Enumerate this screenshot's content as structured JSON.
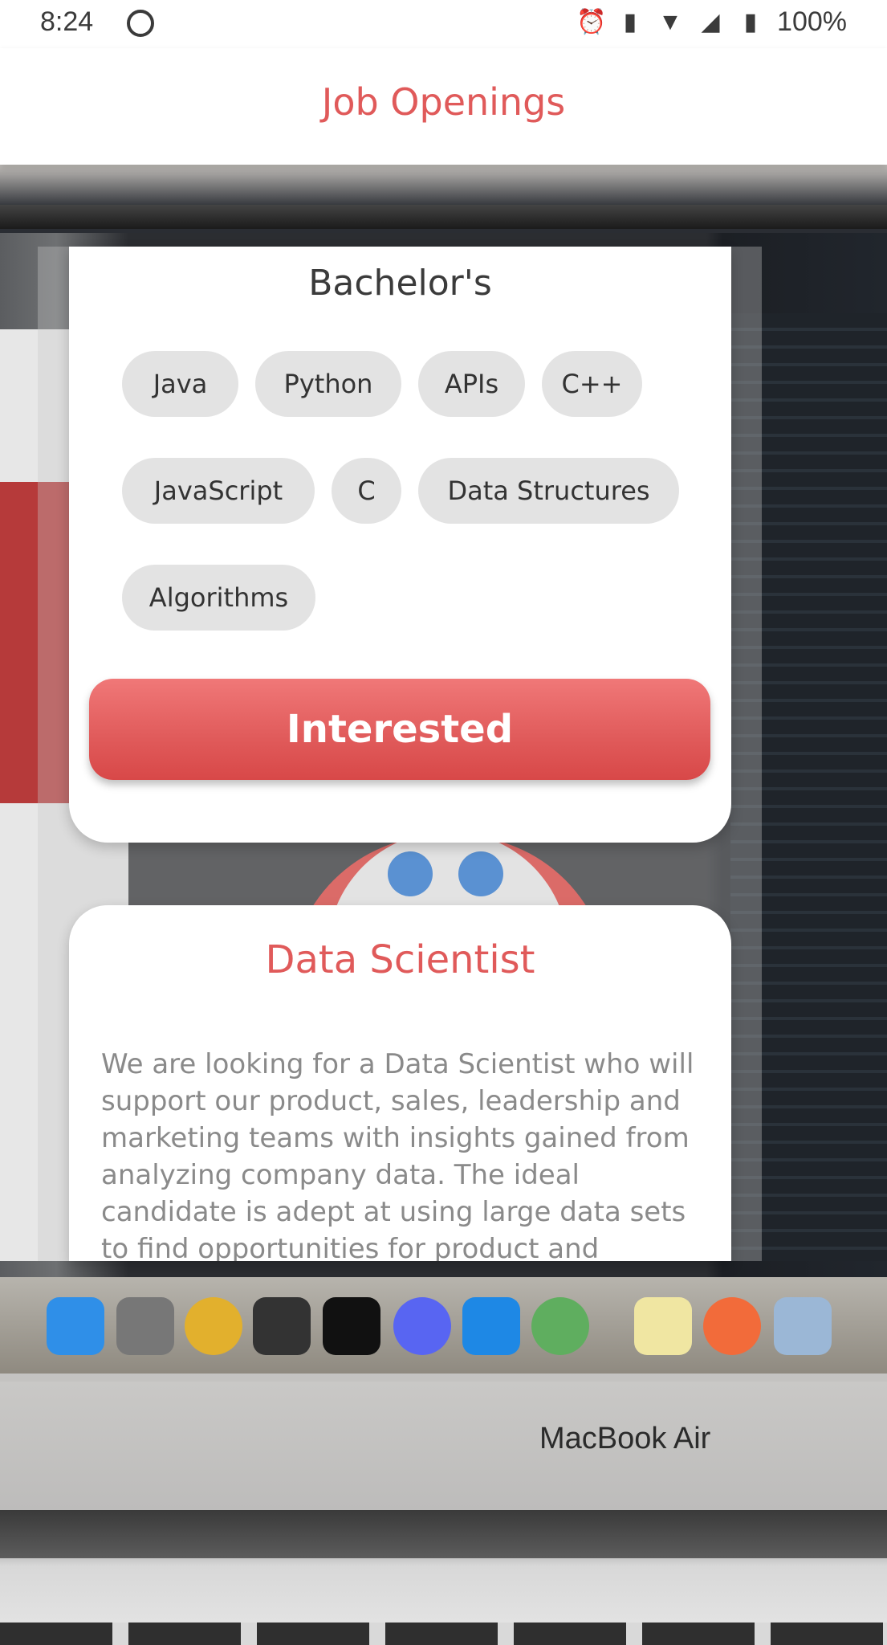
{
  "status_bar": {
    "time": "8:24",
    "battery": "100%",
    "icons": [
      "alarm-icon",
      "vibrate-icon",
      "wifi-icon",
      "signal-icon",
      "battery-icon"
    ]
  },
  "app_bar": {
    "title": "Job Openings"
  },
  "card1": {
    "degree": "Bachelor's",
    "skills": [
      "Java",
      "Python",
      "APIs",
      "C++",
      "JavaScript",
      "C",
      "Data Structures",
      "Algorithms"
    ],
    "button_label": "Interested"
  },
  "card2": {
    "title": "Data Scientist",
    "description": "We are looking for a Data Scientist who will support our product, sales, leadership and marketing teams with insights gained from analyzing company data. The ideal candidate is adept at using large data sets to find opportunities for product and"
  },
  "background": {
    "laptop_label": "MacBook Air"
  },
  "colors": {
    "accent": "#e05a5a",
    "chip_bg": "#e3e3e3",
    "card_bg": "#ffffff"
  }
}
